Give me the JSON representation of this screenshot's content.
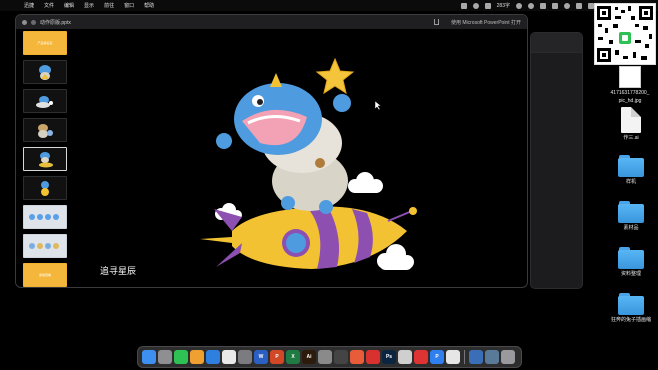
{
  "menubar": {
    "apple_glyph": "",
    "items": [
      "迅捷",
      "文件",
      "编辑",
      "显示",
      "前往",
      "窗口",
      "帮助"
    ],
    "status_text": "283字"
  },
  "window": {
    "filename": "动作原版.pptx",
    "open_with": "使用 Microsoft PowerPoint 打开",
    "caption": "追寻星辰",
    "first_thumb_text": "产品特征表",
    "last_thumb_text": "谢谢观看"
  },
  "desktop": {
    "qr_caption": "4171631778200_...pic_hd.jpg",
    "qr_caption_line1": "4171631778200_",
    "qr_caption_line2": "pic_hd.jpg",
    "ai_file": "作三.ai",
    "folders": [
      "样机",
      "素材品",
      "资料整理",
      "狂奔的兔子插画缩"
    ]
  },
  "dock": {
    "apps": [
      {
        "name": "finder-icon",
        "color": "#3d8ff0",
        "glyph": ""
      },
      {
        "name": "launchpad-icon",
        "color": "#8e8e93",
        "glyph": ""
      },
      {
        "name": "wechat-icon",
        "color": "#2ec254",
        "glyph": ""
      },
      {
        "name": "app-icon",
        "color": "#f0a030",
        "glyph": ""
      },
      {
        "name": "safari-icon",
        "color": "#2f7fe0",
        "glyph": ""
      },
      {
        "name": "chrome-icon",
        "color": "#e9e9e9",
        "glyph": ""
      },
      {
        "name": "settings-icon",
        "color": "#7c7c80",
        "glyph": ""
      },
      {
        "name": "word-icon",
        "color": "#2b5fc2",
        "glyph": "W"
      },
      {
        "name": "powerpoint-icon",
        "color": "#d24726",
        "glyph": "P"
      },
      {
        "name": "excel-icon",
        "color": "#1f7a44",
        "glyph": "X"
      },
      {
        "name": "illustrator-icon",
        "color": "#2c1a0a",
        "glyph": "Ai"
      },
      {
        "name": "app-icon",
        "color": "#8a8a8a",
        "glyph": ""
      },
      {
        "name": "app-icon",
        "color": "#444",
        "glyph": ""
      },
      {
        "name": "app-icon",
        "color": "#e85c3a",
        "glyph": ""
      },
      {
        "name": "netease-music-icon",
        "color": "#d93030",
        "glyph": ""
      },
      {
        "name": "photoshop-icon",
        "color": "#0b2540",
        "glyph": "Ps"
      },
      {
        "name": "app-icon",
        "color": "#cfcfcf",
        "glyph": ""
      },
      {
        "name": "app-icon",
        "color": "#d33",
        "glyph": ""
      },
      {
        "name": "app-icon",
        "color": "#2f7ff0",
        "glyph": "P"
      },
      {
        "name": "app-icon",
        "color": "#e6e6e6",
        "glyph": ""
      },
      {
        "name": "app-icon",
        "color": "#3a6fb8",
        "glyph": ""
      },
      {
        "name": "app-icon",
        "color": "#5a7a9a",
        "glyph": ""
      },
      {
        "name": "trash-icon",
        "color": "#9a9a9e",
        "glyph": ""
      }
    ]
  }
}
